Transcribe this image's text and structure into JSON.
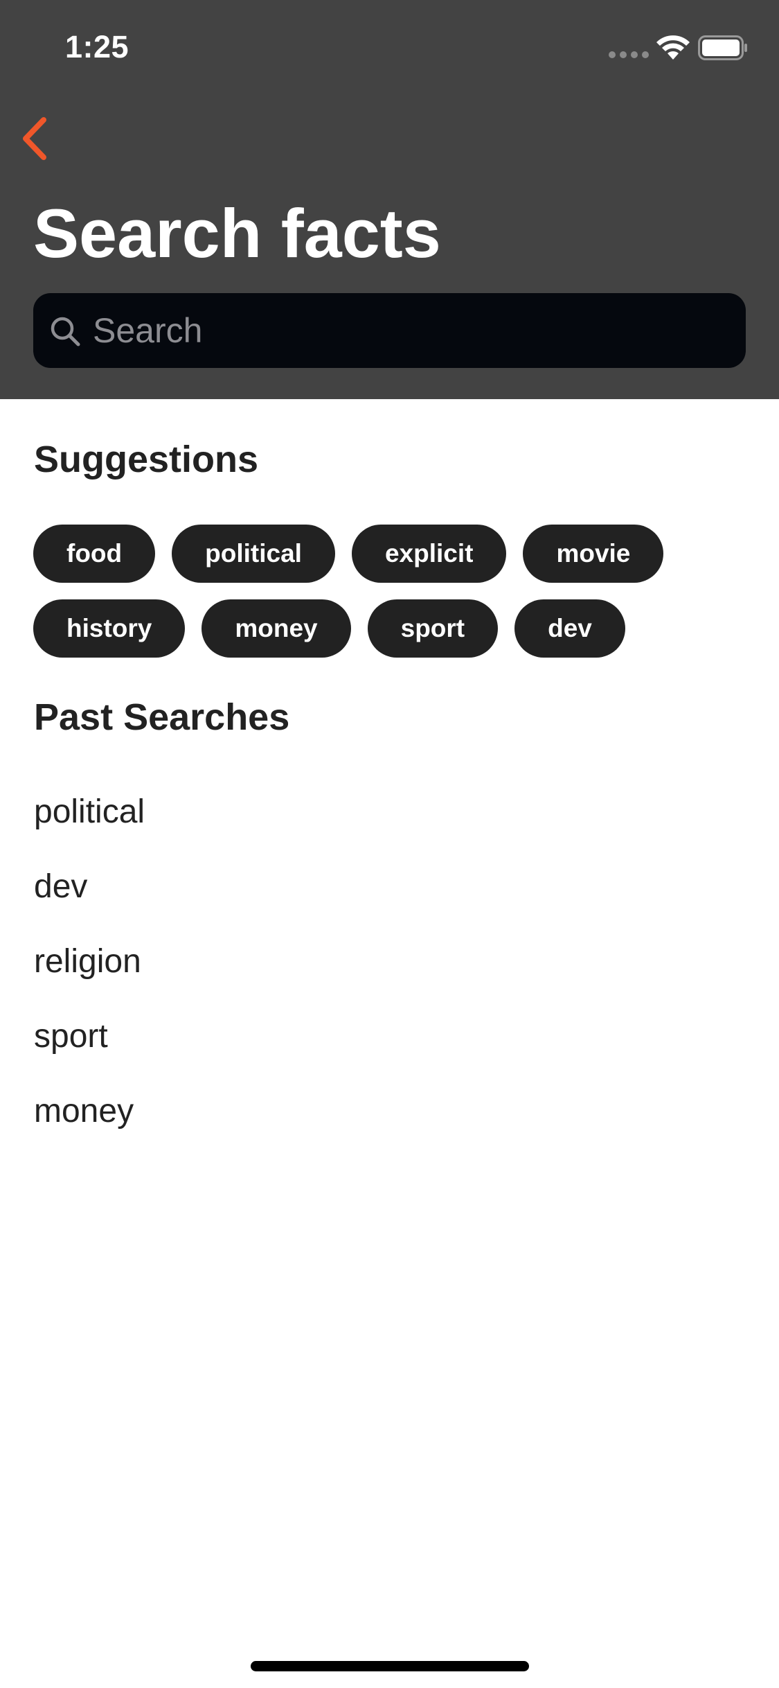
{
  "status_bar": {
    "time": "1:25"
  },
  "header": {
    "title": "Search facts",
    "back_icon": "chevron-left-icon",
    "accent_color": "#f0572a",
    "background_color": "#434343"
  },
  "search": {
    "placeholder": "Search",
    "value": "",
    "icon": "search-icon"
  },
  "suggestions": {
    "heading": "Suggestions",
    "rows": [
      [
        "food",
        "political",
        "explicit",
        "movie"
      ],
      [
        "history",
        "money",
        "sport",
        "dev"
      ]
    ]
  },
  "past_searches": {
    "heading": "Past Searches",
    "items": [
      "political",
      "dev",
      "religion",
      "sport",
      "money"
    ]
  }
}
